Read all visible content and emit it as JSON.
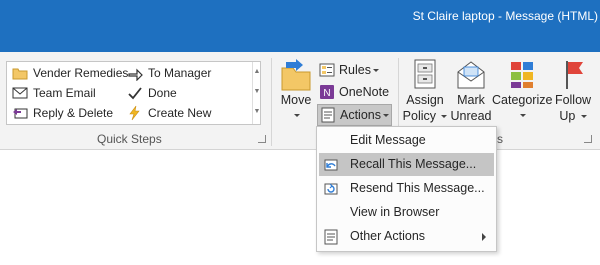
{
  "window": {
    "title": "St Claire laptop - Message (HTML)"
  },
  "quick_steps": {
    "group_label": "Quick Steps",
    "items": [
      {
        "label": "Vender Remedies",
        "icon": "folder-move-icon"
      },
      {
        "label": "To Manager",
        "icon": "forward-arrow-icon"
      },
      {
        "label": "Team Email",
        "icon": "envelope-icon"
      },
      {
        "label": "Done",
        "icon": "checkmark-icon"
      },
      {
        "label": "Reply & Delete",
        "icon": "reply-delete-icon"
      },
      {
        "label": "Create New",
        "icon": "lightning-icon"
      }
    ]
  },
  "move_group": {
    "move_label": "Move",
    "rules_label": "Rules",
    "onenote_label": "OneNote",
    "actions_label": "Actions",
    "group_label_fragment": "M"
  },
  "tags_group": {
    "assign_line1": "Assign",
    "assign_line2": "Policy",
    "mark_line1": "Mark",
    "mark_line2": "Unread",
    "categorize_label": "Categorize",
    "follow_line1": "Follow",
    "follow_line2": "Up",
    "group_label_fragment": "s"
  },
  "actions_menu": {
    "items": [
      {
        "label": "Edit Message",
        "icon": "",
        "has_submenu": false
      },
      {
        "label": "Recall This Message...",
        "icon": "recall-icon",
        "has_submenu": false
      },
      {
        "label": "Resend This Message...",
        "icon": "resend-icon",
        "has_submenu": false
      },
      {
        "label": "View in Browser",
        "icon": "",
        "has_submenu": false
      },
      {
        "label": "Other Actions",
        "icon": "other-actions-icon",
        "has_submenu": true
      }
    ]
  },
  "colors": {
    "titlebar": "#1e70c0",
    "ribbon_bg": "#f3f3f3",
    "menu_hover": "#c5c5c5",
    "onenote_purple": "#7b3a96",
    "flag_red": "#e0443a"
  }
}
